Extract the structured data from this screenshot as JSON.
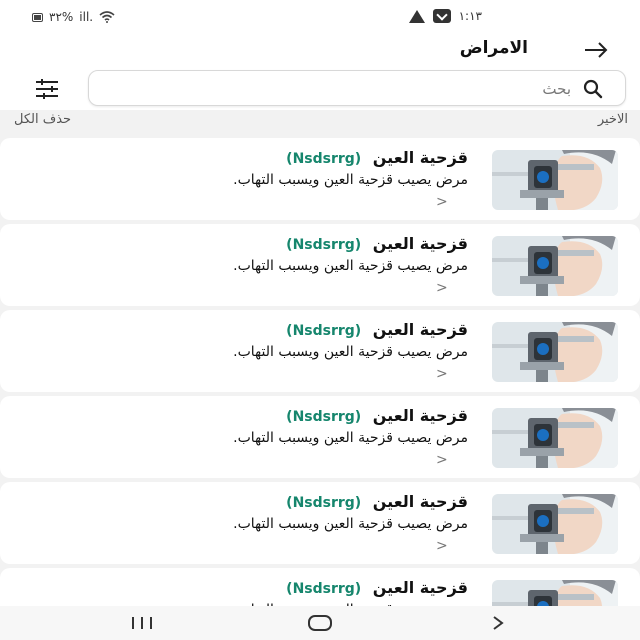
{
  "status_bar": {
    "battery_percent": "٣٢%",
    "signal": "ill.",
    "time": "١:١٣"
  },
  "header": {
    "title": "الامراض",
    "back_icon": "arrow-right-icon"
  },
  "search": {
    "placeholder": "بحث",
    "value": ""
  },
  "section": {
    "recent_label": "الاخير",
    "clear_all_label": "حذف الكل"
  },
  "items": [
    {
      "title": "قزحية العين",
      "code": "(Nsdsrrg)",
      "description": "مرض يصيب قزحية العين ويسبب التهاب.",
      "chevron": ">"
    },
    {
      "title": "قزحية العين",
      "code": "(Nsdsrrg)",
      "description": "مرض يصيب قزحية العين ويسبب التهاب.",
      "chevron": ">"
    },
    {
      "title": "قزحية العين",
      "code": "(Nsdsrrg)",
      "description": "مرض يصيب قزحية العين ويسبب التهاب.",
      "chevron": ">"
    },
    {
      "title": "قزحية العين",
      "code": "(Nsdsrrg)",
      "description": "مرض يصيب قزحية العين ويسبب التهاب.",
      "chevron": ">"
    },
    {
      "title": "قزحية العين",
      "code": "(Nsdsrrg)",
      "description": "مرض يصيب قزحية العين ويسبب التهاب.",
      "chevron": ">"
    },
    {
      "title": "قزحية العين",
      "code": "(Nsdsrrg)",
      "description": "مرض يصيب قزحية العين ويسبب التهاب.",
      "chevron": ">"
    }
  ],
  "colors": {
    "accent_green": "#16866d",
    "background": "#f2f2f2",
    "card": "#ffffff"
  },
  "nav": {
    "recent_apps_icon": "recent-apps-icon",
    "home_icon": "home-icon",
    "back_icon": "back-icon"
  }
}
